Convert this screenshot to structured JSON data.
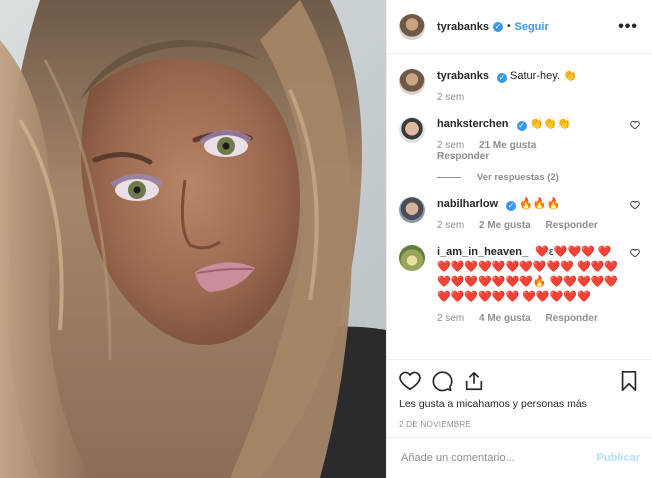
{
  "header": {
    "username": "tyrabanks",
    "separator": "•",
    "follow_label": "Seguir",
    "more_icon": "more-horizontal-icon"
  },
  "caption": {
    "username": "tyrabanks",
    "text": "Satur-hey. 👏",
    "time": "2 sem"
  },
  "comments": [
    {
      "username": "hanksterchen",
      "text": "👏👏👏",
      "time": "2 sem",
      "likes": "21 Me gusta",
      "reply_label": "Responder",
      "view_replies": "Ver respuestas (2)"
    },
    {
      "username": "nabilharlow",
      "text": "🔥🔥🔥",
      "time": "2 sem",
      "likes": "2 Me gusta",
      "reply_label": "Responder"
    },
    {
      "username": "i_am_in_heaven_",
      "text": "❤️ε❤️❤️❤️ ❤️❤️❤️❤️❤️❤️❤️❤️❤️❤️❤️ ❤️❤️❤️❤️❤️❤️❤️❤️❤️❤️🔥 ❤️❤️❤️❤️❤️❤️❤️❤️❤️❤️❤️ ❤️❤️❤️❤️❤️",
      "time": "2 sem",
      "likes": "4 Me gusta",
      "reply_label": "Responder"
    }
  ],
  "actions": {
    "like_icon": "heart-icon",
    "comment_icon": "comment-icon",
    "share_icon": "share-icon",
    "save_icon": "bookmark-icon"
  },
  "likes_text": "Les gusta a micahamos y personas más",
  "date": "2 de noviembre",
  "add_comment": {
    "placeholder": "Añade un comentario...",
    "publish_label": "Publicar"
  },
  "colors": {
    "accent": "#3897f0",
    "publish_disabled": "#b2dffc",
    "muted": "#8e8e8e"
  }
}
